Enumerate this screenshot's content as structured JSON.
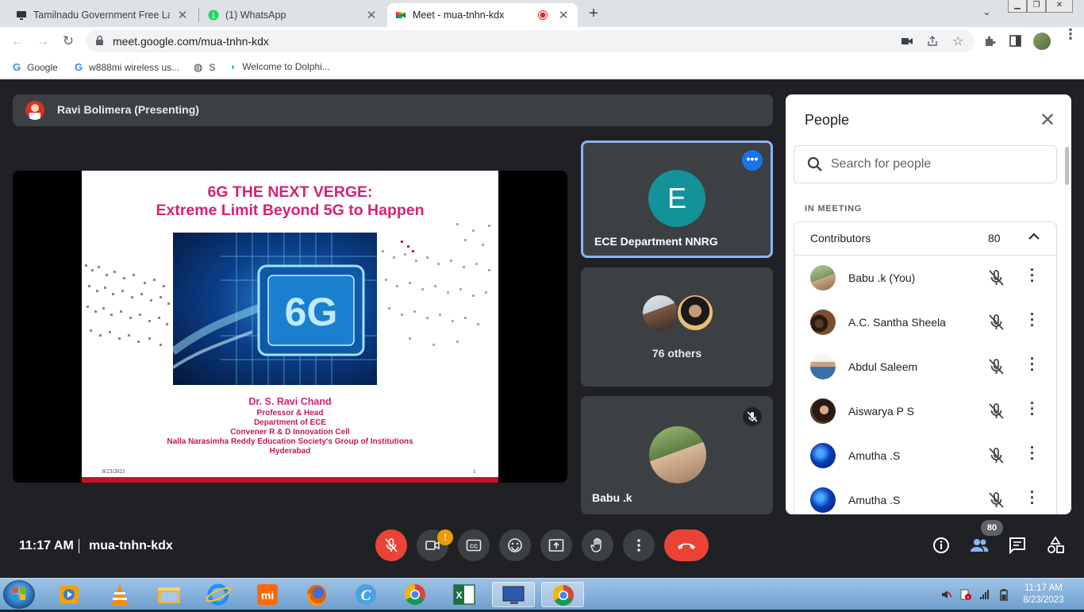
{
  "browser": {
    "tabs": [
      {
        "title": "Tamilnadu Government Free Lapt",
        "close": "✕"
      },
      {
        "title": "(1) WhatsApp",
        "close": "✕"
      },
      {
        "title": "Meet - mua-tnhn-kdx",
        "close": "✕"
      }
    ],
    "new_tab": "+",
    "url": "meet.google.com/mua-tnhn-kdx",
    "bookmarks": [
      {
        "label": "Google"
      },
      {
        "label": "w888mi wireless us..."
      },
      {
        "label": "S"
      },
      {
        "label": "Welcome to Dolphi..."
      }
    ]
  },
  "meet": {
    "presenter": "Ravi Bolimera (Presenting)",
    "slide": {
      "title_line1": "6G THE NEXT VERGE:",
      "title_line2": "Extreme Limit Beyond 5G to Happen",
      "image_text": "6G",
      "author": "Dr. S. Ravi Chand",
      "lines": [
        "Professor & Head",
        "Department of ECE",
        "Convener R & D Innovation Cell",
        "Nalla Narasimha Reddy Education Society's Group of Institutions",
        "Hyderabad"
      ],
      "date": "8/23/2023",
      "page": "1"
    },
    "tiles": {
      "tile1_initial": "E",
      "tile1_name": "ECE Department NNRG",
      "tile2_label": "76 others",
      "tile3_name": "Babu .k"
    },
    "people_panel": {
      "title": "People",
      "search_placeholder": "Search for people",
      "section": "IN MEETING",
      "group_label": "Contributors",
      "group_count": "80",
      "participants": [
        {
          "name": "Babu .k (You)"
        },
        {
          "name": "A.C. Santha Sheela"
        },
        {
          "name": "Abdul Saleem"
        },
        {
          "name": "Aiswarya P S"
        },
        {
          "name": "Amutha .S"
        },
        {
          "name": "Amutha .S"
        }
      ]
    },
    "bottom": {
      "time": "11:17 AM",
      "meeting_code": "mua-tnhn-kdx",
      "camera_warning": "!",
      "people_count": "80"
    }
  },
  "taskbar": {
    "time": "11:17 AM",
    "date": "8/23/2023"
  },
  "colors": {
    "meet_bg": "#202124",
    "tile_bg": "#3c4043",
    "danger_red": "#ea4335",
    "accent_blue": "#1a73e8",
    "slide_title": "#d5236f"
  }
}
